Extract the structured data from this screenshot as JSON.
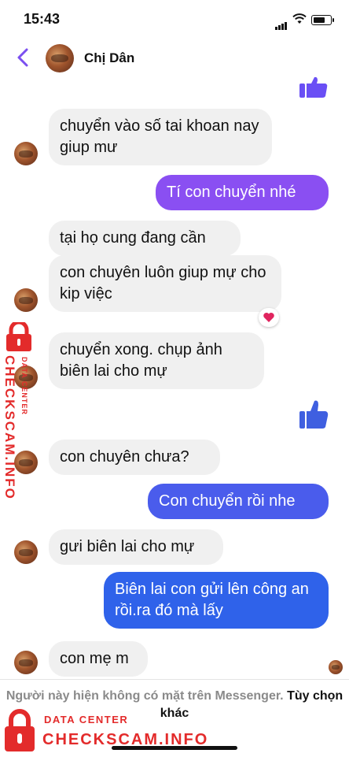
{
  "status_bar": {
    "time": "15:43"
  },
  "header": {
    "contact_name": "Chị Dân"
  },
  "messages": [
    {
      "text": "chuyển vào số tai khoan nay giup mư"
    },
    {
      "text": "Tí con chuyển nhé"
    },
    {
      "text": "tại họ cung đang cần"
    },
    {
      "text": "con chuyên luôn giup mự cho kip việc"
    },
    {
      "text": "chuyển xong. chụp ảnh biên lai cho mự"
    },
    {
      "text": "con chuyên chưa?"
    },
    {
      "text": "Con chuyển rồi nhe"
    },
    {
      "text": "gưi biên lai cho mự"
    },
    {
      "text": "Biên lai con gửi lên công an rồi.ra đó mà lấy"
    },
    {
      "text": "con mẹ m"
    }
  ],
  "reaction": {
    "icon": "heart-icon",
    "color": "#e0245e"
  },
  "bottom_bar": {
    "notice": "Người này hiện không có mặt trên Messenger.",
    "option_link": "Tùy chọn khác"
  },
  "watermark": {
    "line1": "DATA CENTER",
    "line2": "CHECKSCAM.INFO"
  },
  "colors": {
    "accent": "#7b4ff0",
    "outgoing_purple": "#8a4ff2",
    "outgoing_blue": "#2f62ea",
    "incoming_bg": "#f0f0f0",
    "watermark_red": "#e32b2b"
  }
}
